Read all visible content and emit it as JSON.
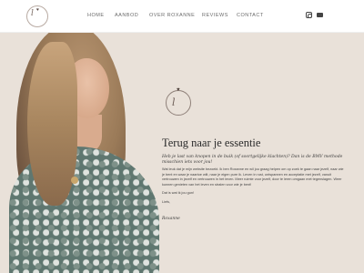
{
  "header": {
    "logo_text": "l",
    "nav": [
      {
        "label": "HOME"
      },
      {
        "label": "AANBOD"
      },
      {
        "label": "OVER ROXANNE"
      },
      {
        "label": "REVIEWS"
      },
      {
        "label": "CONTACT"
      }
    ],
    "social": [
      "instagram-icon",
      "mail-icon"
    ]
  },
  "hero": {
    "badge_text": "l",
    "title": "Terug naar je essentie",
    "script_text": "Heb je last van knopen in de buik (of soortgelijke klachten)? Dan is de BMV methode misschien iets voor jou!",
    "paragraphs": [
      "Wat leuk dat je mijn website bezoekt. Ik ben Roxanne en wil jou graag helpen om op zoek te gaan naar jezelf, naar wie je bent en waar je naartoe wilt, naar je eigen pure ik. Leven in rust, ontspannen en acceptatie met jezelf, vanuit vertrouwen in jezelf en vertrouwen in het leven. Meer ruimte voor jezelf, door te leren omgaan met tegenslagen. Weer kunnen genieten van het leven en stralen voor wie je bent!",
      "Dat is wat ik jou gun!",
      "Liefs,"
    ],
    "signature": "Roxanne"
  }
}
